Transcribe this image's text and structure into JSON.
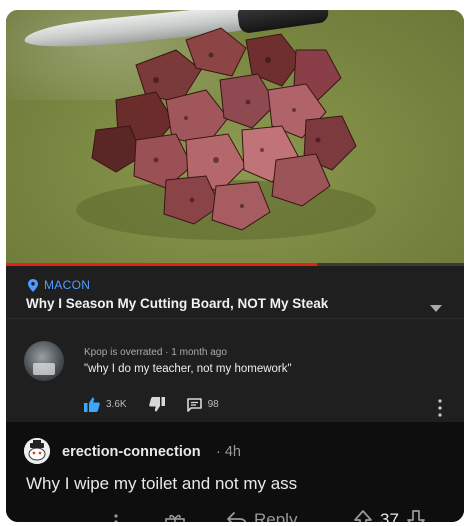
{
  "video": {
    "location": "MACON",
    "title": "Why I Season My Cutting Board, NOT My Steak",
    "progress_fraction": 0.68
  },
  "yt_comment": {
    "author": "Kpop is overrated",
    "separator": "·",
    "time": "1 month ago",
    "text": "\"why I do my teacher, not my homework\"",
    "likes": "3.6K",
    "replies": "98"
  },
  "reddit": {
    "username": "erection-connection",
    "time": "· 4h",
    "body": "Why I wipe my toilet and not my ass",
    "reply_label": "Reply",
    "score": "37"
  },
  "colors": {
    "accent_blue": "#4f9dff",
    "progress_red": "#e62117",
    "card_bg": "#181818",
    "reddit_bg": "#0e0e0e"
  },
  "icons": [
    "knife",
    "location-pin-icon",
    "chevron-down-icon",
    "thumbs-up-icon",
    "thumbs-down-icon",
    "comment-icon",
    "more-vertical-icon",
    "gift-icon",
    "reply-arrow-icon",
    "upvote-icon",
    "downvote-icon"
  ]
}
